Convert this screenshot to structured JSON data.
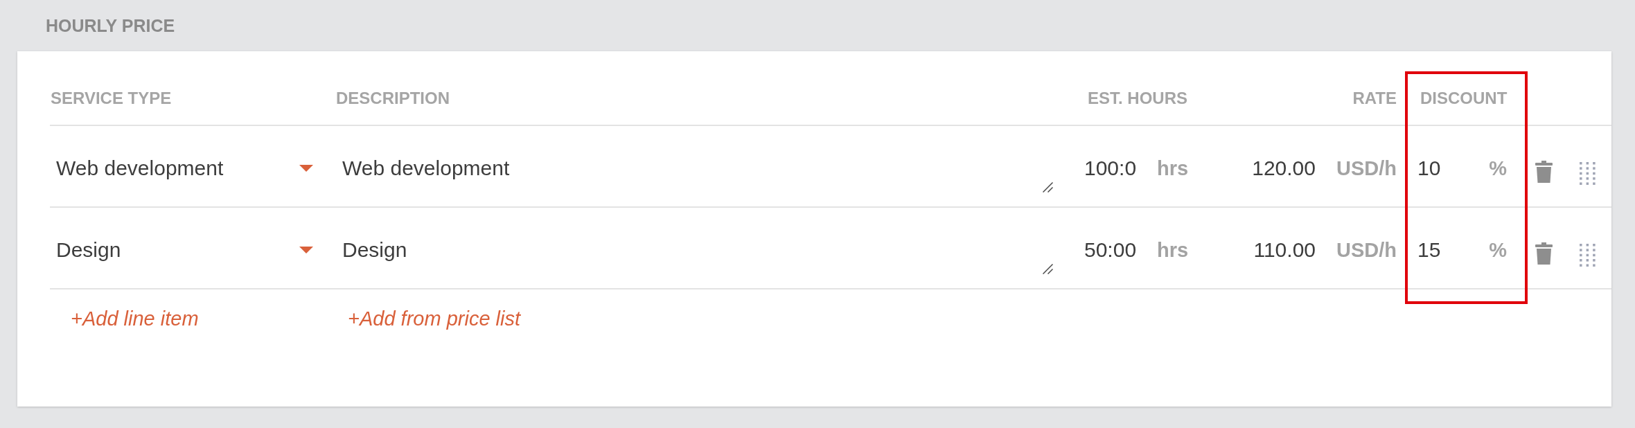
{
  "section": {
    "title": "HOURLY PRICE"
  },
  "table": {
    "columns": [
      {
        "label": "SERVICE TYPE",
        "highlighted": false
      },
      {
        "label": "DESCRIPTION",
        "highlighted": false
      },
      {
        "label": "EST. HOURS",
        "highlighted": false
      },
      {
        "label": "RATE",
        "highlighted": false
      },
      {
        "label": "DISCOUNT",
        "highlighted": true
      }
    ],
    "rows": [
      {
        "service_type": "Web development",
        "description": "Web development",
        "est_hours": "100:0",
        "hours_unit": "hrs",
        "rate": "120.00",
        "rate_unit": "USD/h",
        "discount": "10",
        "discount_unit": "%"
      },
      {
        "service_type": "Design",
        "description": "Design",
        "est_hours": "50:00",
        "hours_unit": "hrs",
        "rate": "110.00",
        "rate_unit": "USD/h",
        "discount": "15",
        "discount_unit": "%"
      }
    ]
  },
  "actions": [
    "+Add line item",
    "+Add from price list"
  ]
}
